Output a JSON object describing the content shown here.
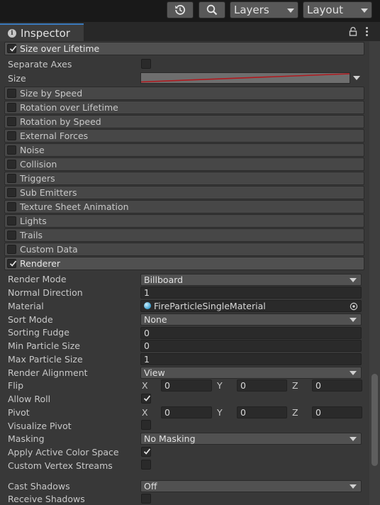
{
  "toolbar": {
    "history_icon": "history-icon",
    "search_icon": "search-icon",
    "layers_label": "Layers",
    "layout_label": "Layout"
  },
  "tab": {
    "title": "Inspector",
    "info_icon": "info-icon",
    "lock_icon": "lock-icon",
    "menu_icon": "kebab-menu-icon"
  },
  "size_over_lifetime": {
    "label": "Size over Lifetime",
    "enabled": true,
    "separate_axes_label": "Separate Axes",
    "size_label": "Size",
    "curve_color": "#b0191e"
  },
  "modules": [
    {
      "label": "Size by Speed",
      "enabled": false
    },
    {
      "label": "Rotation over Lifetime",
      "enabled": false
    },
    {
      "label": "Rotation by Speed",
      "enabled": false
    },
    {
      "label": "External Forces",
      "enabled": false
    },
    {
      "label": "Noise",
      "enabled": false
    },
    {
      "label": "Collision",
      "enabled": false
    },
    {
      "label": "Triggers",
      "enabled": false
    },
    {
      "label": "Sub Emitters",
      "enabled": false
    },
    {
      "label": "Texture Sheet Animation",
      "enabled": false
    },
    {
      "label": "Lights",
      "enabled": false
    },
    {
      "label": "Trails",
      "enabled": false
    },
    {
      "label": "Custom Data",
      "enabled": false
    }
  ],
  "renderer": {
    "label": "Renderer",
    "enabled": true,
    "render_mode": {
      "label": "Render Mode",
      "value": "Billboard"
    },
    "normal_direction": {
      "label": "Normal Direction",
      "value": "1"
    },
    "material": {
      "label": "Material",
      "value": "FireParticleSingleMaterial"
    },
    "sort_mode": {
      "label": "Sort Mode",
      "value": "None"
    },
    "sorting_fudge": {
      "label": "Sorting Fudge",
      "value": "0"
    },
    "min_particle_size": {
      "label": "Min Particle Size",
      "value": "0"
    },
    "max_particle_size": {
      "label": "Max Particle Size",
      "value": "1"
    },
    "render_alignment": {
      "label": "Render Alignment",
      "value": "View"
    },
    "flip": {
      "label": "Flip",
      "x_label": "X",
      "x": "0",
      "y_label": "Y",
      "y": "0",
      "z_label": "Z",
      "z": "0"
    },
    "allow_roll": {
      "label": "Allow Roll",
      "checked": true
    },
    "pivot": {
      "label": "Pivot",
      "x_label": "X",
      "x": "0",
      "y_label": "Y",
      "y": "0",
      "z_label": "Z",
      "z": "0"
    },
    "visualize_pivot": {
      "label": "Visualize Pivot",
      "checked": false
    },
    "masking": {
      "label": "Masking",
      "value": "No Masking"
    },
    "apply_active_color_space": {
      "label": "Apply Active Color Space",
      "checked": true
    },
    "custom_vertex_streams": {
      "label": "Custom Vertex Streams",
      "checked": false
    },
    "cast_shadows": {
      "label": "Cast Shadows",
      "value": "Off"
    },
    "receive_shadows": {
      "label": "Receive Shadows",
      "checked": false
    }
  }
}
